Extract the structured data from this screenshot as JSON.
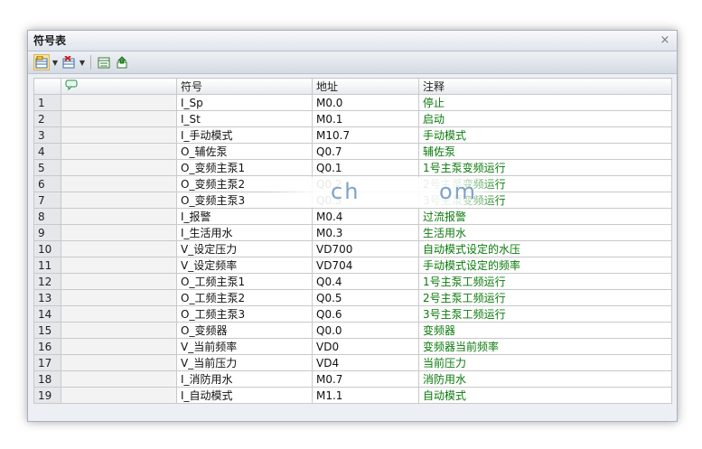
{
  "window": {
    "title": "符号表",
    "close_glyph": "×"
  },
  "toolbar": {
    "buttons": [
      {
        "name": "insert-row-icon"
      },
      {
        "name": "delete-row-icon"
      },
      {
        "name": "symbol-table-view-icon"
      },
      {
        "name": "apply-symbols-icon"
      }
    ]
  },
  "table": {
    "headers": [
      "",
      "",
      "符号",
      "地址",
      "注释"
    ],
    "rows": [
      {
        "n": "1",
        "symbol": "I_Sp",
        "address": "M0.0",
        "comment": "停止"
      },
      {
        "n": "2",
        "symbol": "I_St",
        "address": "M0.1",
        "comment": "启动"
      },
      {
        "n": "3",
        "symbol": "I_手动模式",
        "address": "M10.7",
        "comment": "手动模式"
      },
      {
        "n": "4",
        "symbol": "O_辅佐泵",
        "address": "Q0.7",
        "comment": "辅佐泵"
      },
      {
        "n": "5",
        "symbol": "O_变频主泵1",
        "address": "Q0.1",
        "comment": "1号主泵变频运行"
      },
      {
        "n": "6",
        "symbol": "O_变频主泵2",
        "address": "Q0.2",
        "comment": "2号主泵变频运行"
      },
      {
        "n": "7",
        "symbol": "O_变频主泵3",
        "address": "Q0.3",
        "comment": "3号主泵变频运行"
      },
      {
        "n": "8",
        "symbol": "I_报警",
        "address": "M0.4",
        "comment": "过流报警"
      },
      {
        "n": "9",
        "symbol": "I_生活用水",
        "address": "M0.3",
        "comment": "生活用水"
      },
      {
        "n": "10",
        "symbol": "V_设定压力",
        "address": "VD700",
        "comment": "自动模式设定的水压"
      },
      {
        "n": "11",
        "symbol": "V_设定频率",
        "address": "VD704",
        "comment": "手动模式设定的频率"
      },
      {
        "n": "12",
        "symbol": "O_工频主泵1",
        "address": "Q0.4",
        "comment": "1号主泵工频运行"
      },
      {
        "n": "13",
        "symbol": "O_工频主泵2",
        "address": "Q0.5",
        "comment": "2号主泵工频运行"
      },
      {
        "n": "14",
        "symbol": "O_工频主泵3",
        "address": "Q0.6",
        "comment": "3号主泵工频运行"
      },
      {
        "n": "15",
        "symbol": "O_变频器",
        "address": "Q0.0",
        "comment": "变频器"
      },
      {
        "n": "16",
        "symbol": "V_当前频率",
        "address": "VD0",
        "comment": "变频器当前频率"
      },
      {
        "n": "17",
        "symbol": "V_当前压力",
        "address": "VD4",
        "comment": "当前压力"
      },
      {
        "n": "18",
        "symbol": "I_消防用水",
        "address": "M0.7",
        "comment": "消防用水"
      },
      {
        "n": "19",
        "symbol": "I_自动模式",
        "address": "M1.1",
        "comment": "自动模式"
      }
    ]
  },
  "watermark": {
    "part1": "ch",
    "part2": "om"
  },
  "colors": {
    "comment_text": "#0b7a0b",
    "row_header_bg": "#e5e7eb",
    "selected_button_bg": "#f7e4a6"
  }
}
